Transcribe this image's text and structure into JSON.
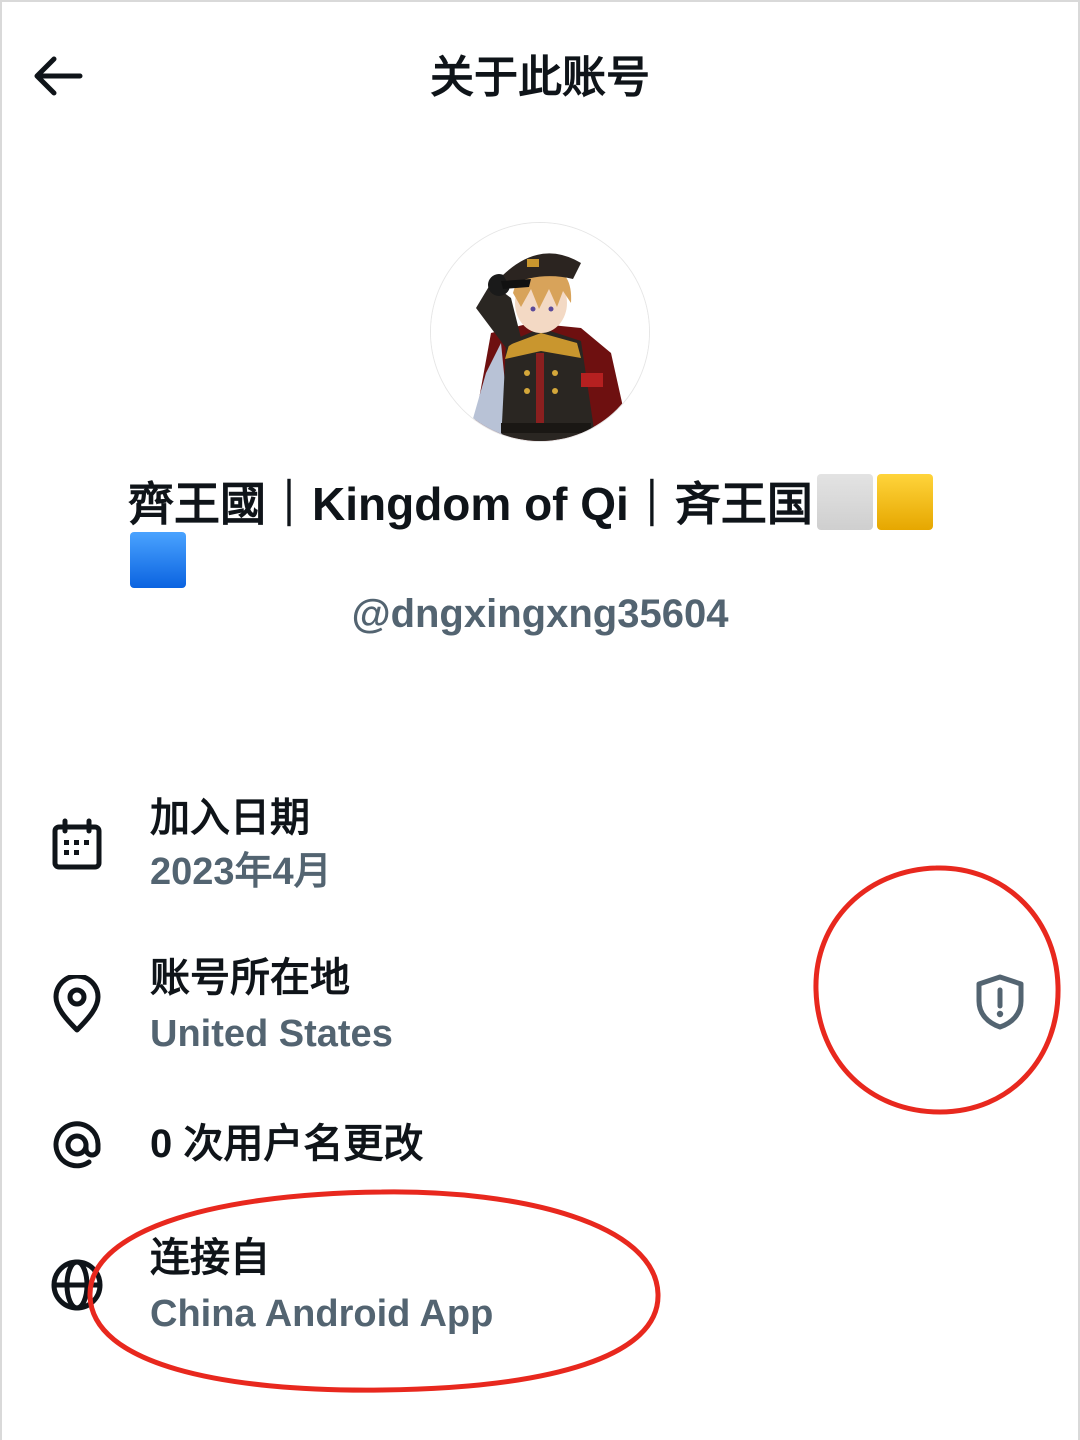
{
  "header": {
    "title": "关于此账号",
    "back_icon": "arrow-left-icon"
  },
  "profile": {
    "display_name": "齊王國｜Kingdom of Qi｜斉王国",
    "name_emojis": [
      "white-square",
      "yellow-square",
      "blue-square"
    ],
    "handle": "@dngxingxng35604"
  },
  "details": [
    {
      "icon": "calendar-icon",
      "label": "加入日期",
      "value": "2023年4月"
    },
    {
      "icon": "location-pin-icon",
      "label": "账号所在地",
      "value": "United States",
      "action_icon": "shield-alert-icon"
    },
    {
      "icon": "at-sign-icon",
      "label": "0 次用户名更改"
    },
    {
      "icon": "globe-icon",
      "label": "连接自",
      "value": "China Android App"
    }
  ],
  "annotation_color": "#e8281e",
  "text_color": "#0f1419",
  "secondary_color": "#536471"
}
